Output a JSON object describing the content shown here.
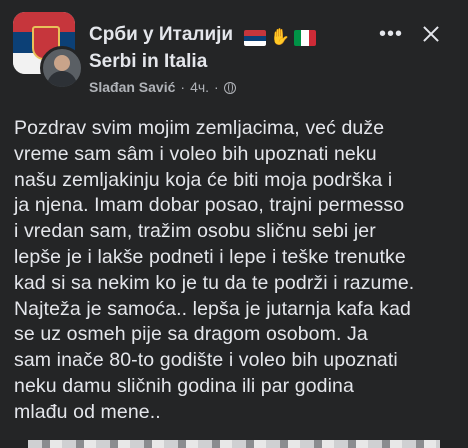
{
  "header": {
    "group_title": "Срби у Италији",
    "group_subtitle": "Serbi in Italia",
    "flags": [
      "serbia-flag",
      "handshake-emoji",
      "italy-flag"
    ],
    "author": "Slađan Savić",
    "separator": "·",
    "time": "4ч.",
    "audience_icon": "globe-icon",
    "more_icon": "•••",
    "close_icon": "close-icon"
  },
  "post": {
    "lines": [
      "Pozdrav svim mojim zemljacima, već duže",
      "vreme sam sâm i voleo bih upoznati neku",
      "našu zemljakinju koja će biti moja podrška i",
      "ja njena. Imam dobar posao, trajni permesso",
      "i vredan sam, tražim osobu sličnu sebi jer",
      "lepše je i lakše podneti i lepe i teške trenutke",
      "kad si sa nekim ko je tu da te podrži i razume.",
      "Najteža je samoća.. lepša je jutarnja kafa kad",
      "se uz osmeh pije sa dragom osobom. Ja",
      "sam inače 80-to godište i voleo bih upoznati",
      "neku damu sličnih godina ili par godina",
      "mlađu od mene.."
    ]
  },
  "colors": {
    "background": "#242526",
    "text_primary": "#e4e6eb",
    "text_secondary": "#b0b3b8"
  }
}
